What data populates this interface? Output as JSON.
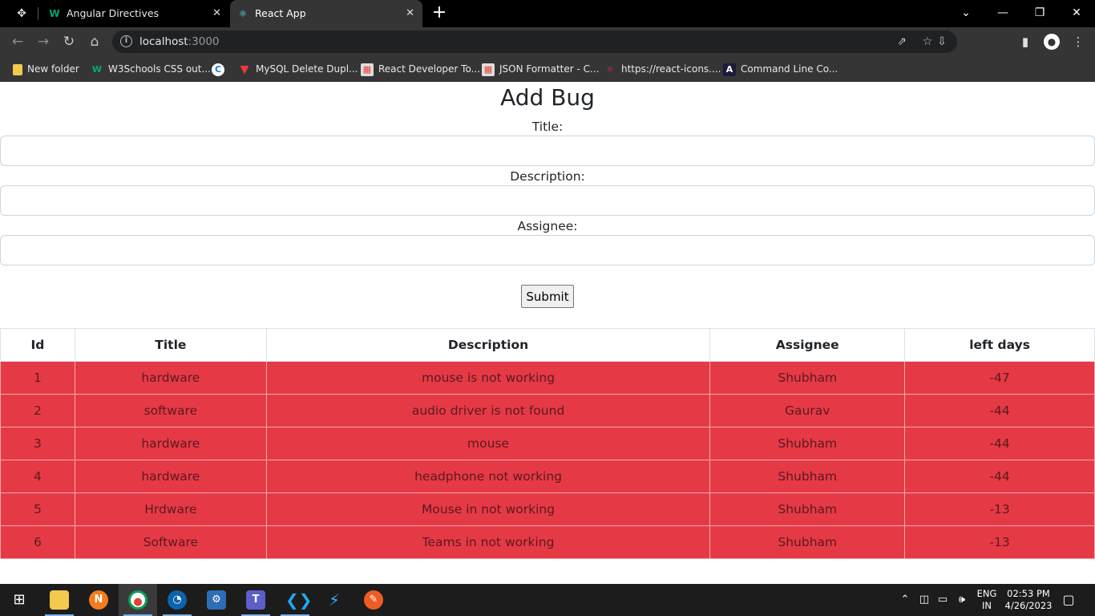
{
  "browser": {
    "tabs": [
      {
        "label": "Angular Directives",
        "favicon": "W",
        "active": false
      },
      {
        "label": "React App",
        "favicon": "⚛",
        "active": true
      }
    ],
    "url_host": "localhost",
    "url_port": ":3000",
    "bookmarks": [
      {
        "label": "New folder",
        "icon": "folder-icon"
      },
      {
        "label": "W3Schools CSS out...",
        "icon": "w3schools-icon"
      },
      {
        "label": "",
        "icon": "chrome-web-store-icon"
      },
      {
        "label": "MySQL Delete Dupl...",
        "icon": "vivaldi-v-icon"
      },
      {
        "label": "React Developer To...",
        "icon": "chrome-store-icon"
      },
      {
        "label": "JSON Formatter - C...",
        "icon": "chrome-store-icon"
      },
      {
        "label": "https://react-icons....",
        "icon": "react-icon"
      },
      {
        "label": "Command Line Co...",
        "icon": "angular-icon"
      }
    ]
  },
  "form": {
    "heading": "Add Bug",
    "title_label": "Title:",
    "title_value": "",
    "description_label": "Description:",
    "description_value": "",
    "assignee_label": "Assignee:",
    "assignee_value": "",
    "submit_label": "Submit"
  },
  "table": {
    "headers": [
      "Id",
      "Title",
      "Description",
      "Assignee",
      "left days"
    ],
    "rows": [
      [
        "1",
        "hardware",
        "mouse is not working",
        "Shubham",
        "-47"
      ],
      [
        "2",
        "software",
        "audio driver is not found",
        "Gaurav",
        "-44"
      ],
      [
        "3",
        "hardware",
        "mouse",
        "Shubham",
        "-44"
      ],
      [
        "4",
        "hardware",
        "headphone not working",
        "Shubham",
        "-44"
      ],
      [
        "5",
        "Hrdware",
        "Mouse in not working",
        "Shubham",
        "-13"
      ],
      [
        "6",
        "Software",
        "Teams in not working",
        "Shubham",
        "-13"
      ]
    ],
    "row_color": "#e63946"
  },
  "taskbar": {
    "lang_line1": "ENG",
    "lang_line2": "IN",
    "time": "02:53 PM",
    "date": "4/26/2023"
  }
}
